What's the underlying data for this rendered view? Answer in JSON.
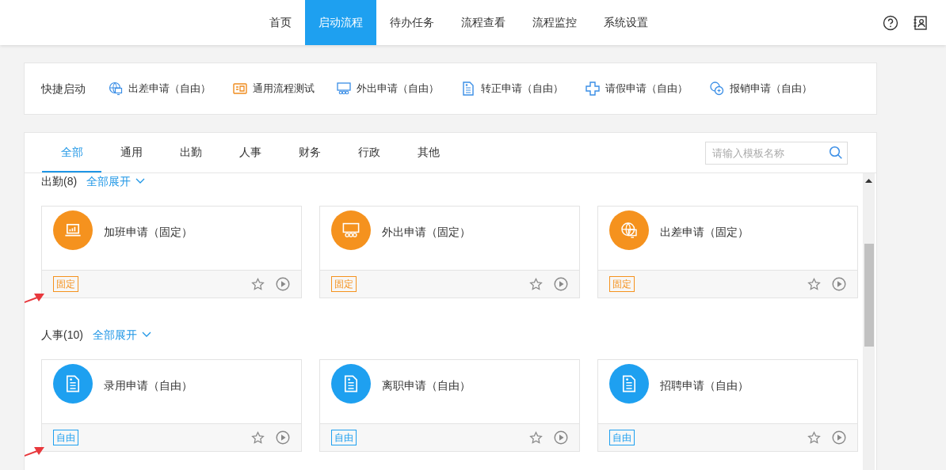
{
  "nav": {
    "items": [
      {
        "label": "首页",
        "selected": false
      },
      {
        "label": "启动流程",
        "selected": true
      },
      {
        "label": "待办任务",
        "selected": false
      },
      {
        "label": "流程查看",
        "selected": false
      },
      {
        "label": "流程监控",
        "selected": false
      },
      {
        "label": "系统设置",
        "selected": false
      }
    ]
  },
  "quick_start": {
    "label": "快捷启动",
    "items": [
      {
        "label": "出差申请（自由）",
        "kind": "globe"
      },
      {
        "label": "通用流程测试",
        "kind": "board"
      },
      {
        "label": "外出申请（自由）",
        "kind": "screen"
      },
      {
        "label": "转正申请（自由）",
        "kind": "document"
      },
      {
        "label": "请假申请（自由）",
        "kind": "cross"
      },
      {
        "label": "报销申请（自由）",
        "kind": "coins"
      }
    ]
  },
  "tabs": [
    {
      "label": "全部",
      "selected": true
    },
    {
      "label": "通用",
      "selected": false
    },
    {
      "label": "出勤",
      "selected": false
    },
    {
      "label": "人事",
      "selected": false
    },
    {
      "label": "财务",
      "selected": false
    },
    {
      "label": "行政",
      "selected": false
    },
    {
      "label": "其他",
      "selected": false
    }
  ],
  "search": {
    "placeholder": "请输入模板名称"
  },
  "groups": [
    {
      "title": "出勤(8)",
      "expand": "全部展开",
      "cards": [
        {
          "title": "加班申请（固定）",
          "kind": "laptop",
          "tag": "固定",
          "color": "#f5921e",
          "pointer_arrow": true
        },
        {
          "title": "外出申请（固定）",
          "kind": "screen",
          "tag": "固定",
          "color": "#f5921e",
          "pointer_arrow": false
        },
        {
          "title": "出差申请（固定）",
          "kind": "globe",
          "tag": "固定",
          "color": "#f5921e",
          "pointer_arrow": false
        }
      ]
    },
    {
      "title": "人事(10)",
      "expand": "全部展开",
      "cards": [
        {
          "title": "录用申请（自由）",
          "kind": "document",
          "tag": "自由",
          "color": "#1ea0f0",
          "pointer_arrow": true
        },
        {
          "title": "离职申请（自由）",
          "kind": "document",
          "tag": "自由",
          "color": "#1ea0f0",
          "pointer_arrow": false
        },
        {
          "title": "招聘申请（自由）",
          "kind": "document",
          "tag": "自由",
          "color": "#1ea0f0",
          "pointer_arrow": false
        }
      ]
    }
  ]
}
